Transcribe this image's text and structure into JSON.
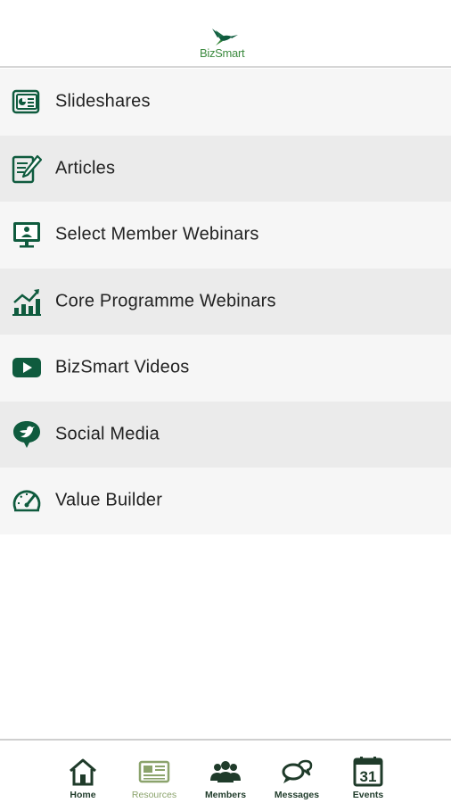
{
  "app": {
    "logo_text": "BizSmart",
    "brand_color": "#0f5b3e",
    "accent_color": "#3c8a3f"
  },
  "menu": {
    "items": [
      {
        "label": "Slideshares",
        "icon": "slideshow-icon"
      },
      {
        "label": "Articles",
        "icon": "article-edit-icon"
      },
      {
        "label": "Select Member Webinars",
        "icon": "presentation-screen-icon"
      },
      {
        "label": "Core Programme Webinars",
        "icon": "growth-chart-icon"
      },
      {
        "label": "BizSmart Videos",
        "icon": "video-play-icon"
      },
      {
        "label": "Social Media",
        "icon": "social-bird-icon"
      },
      {
        "label": "Value Builder",
        "icon": "speedometer-icon"
      }
    ]
  },
  "tabbar": {
    "active": "Resources",
    "tabs": [
      {
        "label": "Home",
        "icon": "home-icon"
      },
      {
        "label": "Resources",
        "icon": "newspaper-icon"
      },
      {
        "label": "Members",
        "icon": "members-group-icon"
      },
      {
        "label": "Messages",
        "icon": "chat-bubbles-icon"
      },
      {
        "label": "Events",
        "icon": "calendar-icon",
        "day": "31"
      }
    ]
  }
}
